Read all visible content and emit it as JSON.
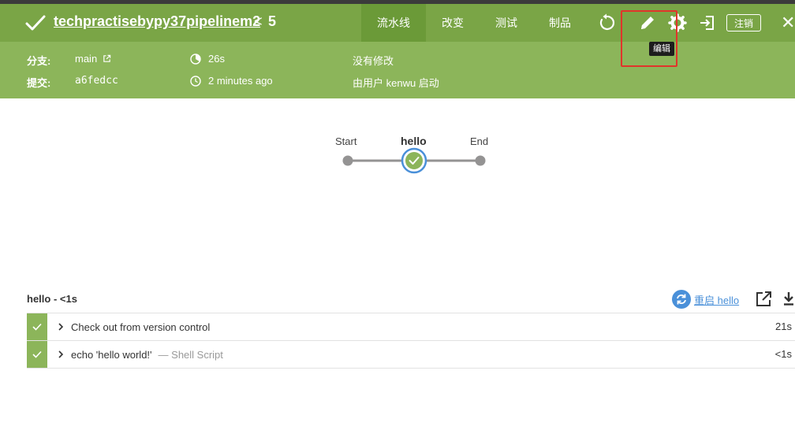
{
  "header": {
    "run_title": "techpractisebypy37pipelinem2",
    "run_separator": "<",
    "run_number": "5",
    "tabs": [
      {
        "label": "流水线",
        "active": true
      },
      {
        "label": "改变",
        "active": false
      },
      {
        "label": "测试",
        "active": false
      },
      {
        "label": "制品",
        "active": false
      }
    ],
    "tooltip": "编辑",
    "logout_label": "注销",
    "close_label": "✕",
    "icons": [
      "replay-icon",
      "pencil-icon",
      "gear-icon",
      "exit-icon"
    ]
  },
  "meta": {
    "branch_label": "分支:",
    "branch_value": "main",
    "commit_label": "提交:",
    "commit_value": "a6fedcc",
    "duration": "26s",
    "time_ago": "2 minutes ago",
    "changes": "没有修改",
    "started_by": "由用户 kenwu 启动"
  },
  "graph": {
    "nodes": [
      {
        "label": "Start",
        "kind": "start"
      },
      {
        "label": "hello",
        "kind": "stage",
        "selected": true
      },
      {
        "label": "End",
        "kind": "end"
      }
    ]
  },
  "stage_detail": {
    "title": "hello - <1s",
    "restart_label": "重启 hello",
    "steps": [
      {
        "name": "Check out from version control",
        "desc": "",
        "duration": "21s"
      },
      {
        "name": "echo 'hello world!'",
        "desc": "— Shell Script",
        "duration": "<1s"
      }
    ]
  },
  "colors": {
    "header_green": "#8cb55a",
    "titlebar_green": "#7aa546",
    "success_green": "#8cb55a",
    "link_blue": "#4a90d9",
    "highlight_red": "#e0352b"
  }
}
